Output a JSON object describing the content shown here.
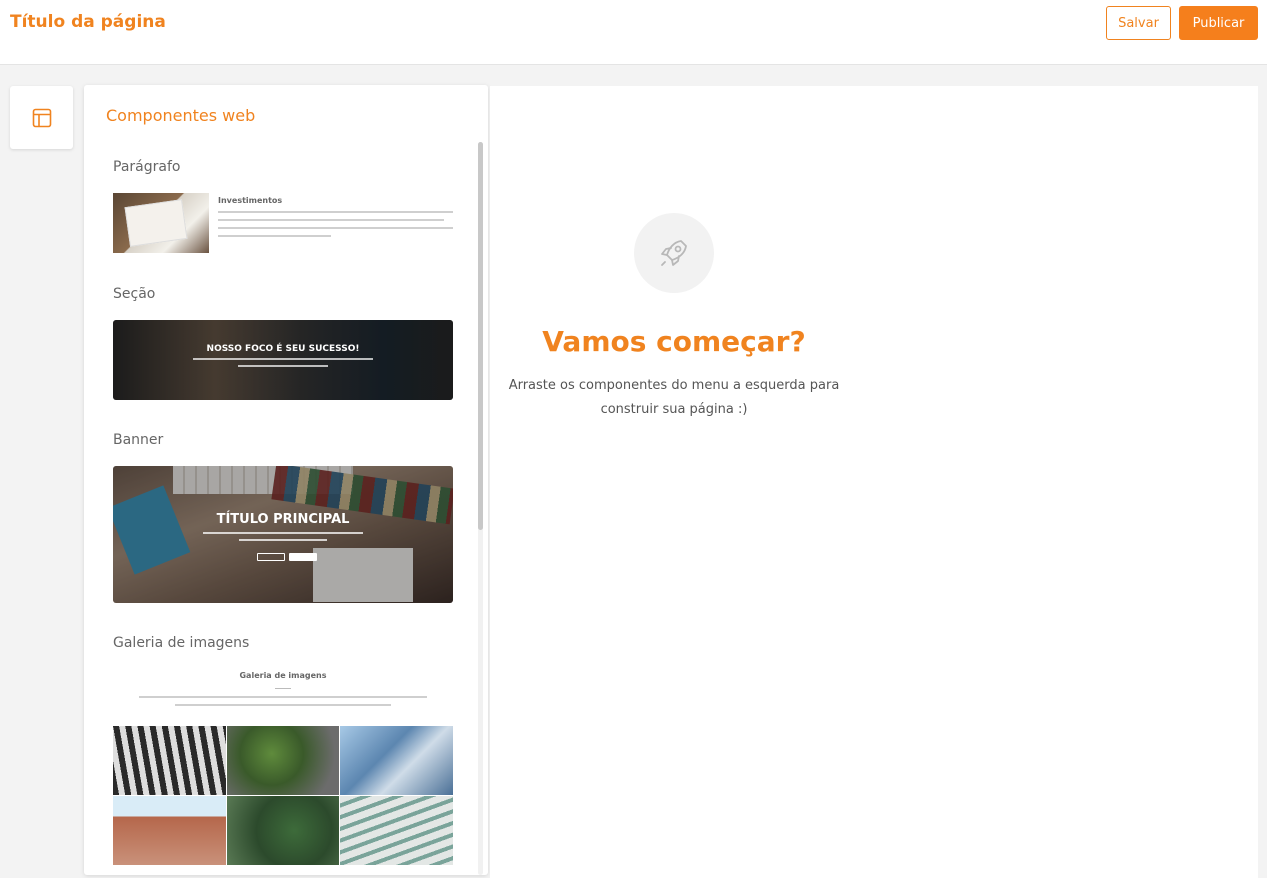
{
  "header": {
    "title": "Título da página",
    "save_label": "Salvar",
    "publish_label": "Publicar"
  },
  "sidebar": {
    "tab_icon": "layout-icon"
  },
  "panel": {
    "title": "Componentes web",
    "sections": [
      {
        "label": "Parágrafo",
        "preview_title": "Investimentos"
      },
      {
        "label": "Seção",
        "preview_title": "NOSSO FOCO É SEU SUCESSO!"
      },
      {
        "label": "Banner",
        "preview_title": "TÍTULO PRINCIPAL"
      },
      {
        "label": "Galeria de imagens",
        "preview_title": "Galeria de imagens"
      }
    ]
  },
  "empty_state": {
    "icon": "rocket-icon",
    "headline": "Vamos começar?",
    "line1": "Arraste os componentes do menu a esquerda para",
    "line2": "construir sua página :)"
  },
  "colors": {
    "accent": "#f0831f",
    "publish_bg": "#f57f1c"
  }
}
